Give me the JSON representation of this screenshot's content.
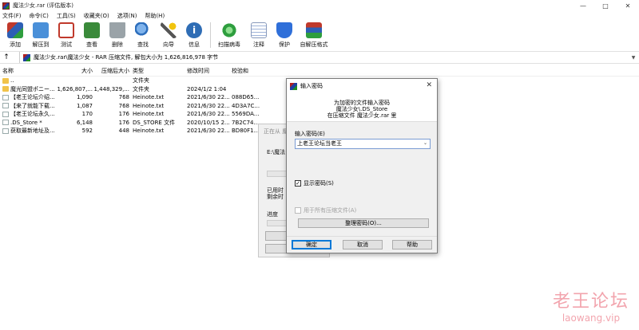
{
  "window": {
    "title": "魔法少女.rar (评估版本)",
    "controls": [
      "—",
      "□",
      "✕"
    ]
  },
  "menu": [
    "文件(F)",
    "命令(C)",
    "工具(S)",
    "收藏夹(O)",
    "选项(N)",
    "帮助(H)"
  ],
  "toolbar": [
    {
      "label": "添加",
      "icon": "add-archive-icon",
      "color": "#c0392b"
    },
    {
      "label": "解压到",
      "icon": "extract-folder-icon",
      "color": "#4a90d9"
    },
    {
      "label": "测试",
      "icon": "test-checklist-icon",
      "color": "#c0392b"
    },
    {
      "label": "查看",
      "icon": "view-book-icon",
      "color": "#3a8a3a"
    },
    {
      "label": "删除",
      "icon": "trash-icon",
      "color": "#7f8c8d"
    },
    {
      "label": "查找",
      "icon": "magnifier-icon",
      "color": "#2e6fbd"
    },
    {
      "label": "向导",
      "icon": "wizard-wand-icon",
      "color": "#d4a017"
    },
    {
      "label": "信息",
      "icon": "info-icon",
      "color": "#2f6db5"
    },
    {
      "label": "扫描病毒",
      "icon": "virus-scan-icon",
      "color": "#2e9e3e"
    },
    {
      "label": "注释",
      "icon": "comment-note-icon",
      "color": "#9fb4d9"
    },
    {
      "label": "保护",
      "icon": "shield-icon",
      "color": "#2f6fd9"
    },
    {
      "label": "自解压格式",
      "icon": "sfx-box-icon",
      "color": "#c0392b"
    }
  ],
  "address": {
    "path": "魔法少女.rar\\魔法少女 - RAR 压缩文件, 解包大小为 1,626,816,978 字节"
  },
  "filelist": {
    "columns": [
      "名称",
      "大小",
      "压缩后大小",
      "类型",
      "修改时间",
      "校验和"
    ],
    "rows": [
      {
        "name": "..",
        "size": "",
        "packed": "",
        "type": "文件夹",
        "modified": "",
        "crc": "",
        "kind": "folder"
      },
      {
        "name": "魔光同盟ポニー...",
        "size": "1,626,807,...",
        "packed": "1,448,329,...",
        "type": "文件夹",
        "modified": "2024/1/2 1:04",
        "crc": "",
        "kind": "folder"
      },
      {
        "name": "【老王论坛介绍...",
        "size": "1,090",
        "packed": "768",
        "type": "Heinote.txt",
        "modified": "2021/6/30 22...",
        "crc": "088D65...",
        "kind": "file"
      },
      {
        "name": "【来了就能下载...",
        "size": "1,087",
        "packed": "768",
        "type": "Heinote.txt",
        "modified": "2021/6/30 22...",
        "crc": "4D3A7C...",
        "kind": "file"
      },
      {
        "name": "【老王论坛永久...",
        "size": "170",
        "packed": "176",
        "type": "Heinote.txt",
        "modified": "2021/6/30 22...",
        "crc": "5569DA...",
        "kind": "file"
      },
      {
        "name": ".DS_Store *",
        "size": "6,148",
        "packed": "176",
        "type": "DS_STORE 文件",
        "modified": "2020/10/15 2...",
        "crc": "7B2C74...",
        "kind": "file"
      },
      {
        "name": "获取最新地址及...",
        "size": "592",
        "packed": "448",
        "type": "Heinote.txt",
        "modified": "2021/6/30 22...",
        "crc": "BD80F1...",
        "kind": "file"
      }
    ]
  },
  "bgwindow": {
    "title": "正在从 魔法少女",
    "line1": "E:\\魔法",
    "line2": "已用时",
    "line3": "剩余时",
    "line4": "进度"
  },
  "dialog": {
    "title": "输入密码",
    "head_line1": "为加密的文件输入密码",
    "head_line2": "魔法少女\\.DS_Store",
    "head_line3": "在压缩文件 魔法少女.rar 里",
    "label": "输入密码(E)",
    "password": "上老王论坛当老王",
    "show_password": "显示密码(S)",
    "use_for_all": "用于所有压缩文件(A)",
    "organize": "整理密码(O)...",
    "ok": "确定",
    "cancel": "取消",
    "help": "帮助"
  },
  "watermark": {
    "line1": "老王论坛",
    "line2": "laowang.vip"
  }
}
